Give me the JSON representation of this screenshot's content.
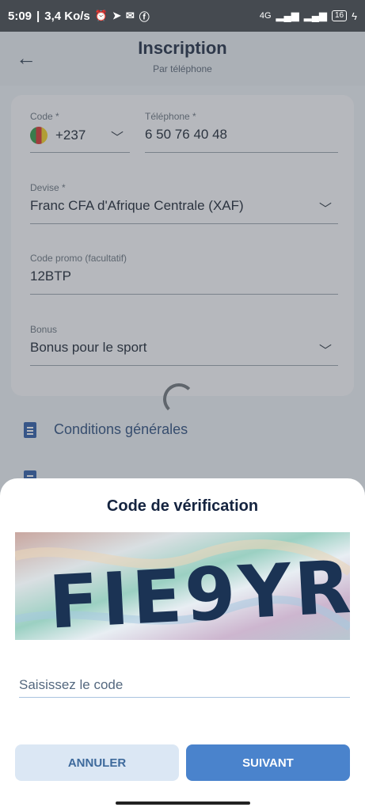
{
  "status_bar": {
    "time": "5:09",
    "speed": "3,4 Ko/s",
    "network": "4G",
    "battery": "16"
  },
  "header": {
    "title": "Inscription",
    "subtitle": "Par téléphone"
  },
  "form": {
    "code_label": "Code *",
    "code_value": "+237",
    "phone_label": "Téléphone *",
    "phone_value": "6 50 76 40 48",
    "currency_label": "Devise *",
    "currency_value": "Franc CFA d'Afrique Centrale (XAF)",
    "promo_label": "Code promo (facultatif)",
    "promo_value": "12BTP",
    "bonus_label": "Bonus",
    "bonus_value": "Bonus pour le sport"
  },
  "links": {
    "terms": "Conditions générales"
  },
  "dialog": {
    "title": "Code de vérification",
    "captcha_text": "FIE9YR",
    "input_placeholder": "Saisissez le code",
    "cancel_label": "ANNULER",
    "next_label": "SUIVANT"
  },
  "colors": {
    "accent": "#4a83cc",
    "cancel_bg": "#dbe7f4",
    "dialog_title": "#14233f"
  }
}
